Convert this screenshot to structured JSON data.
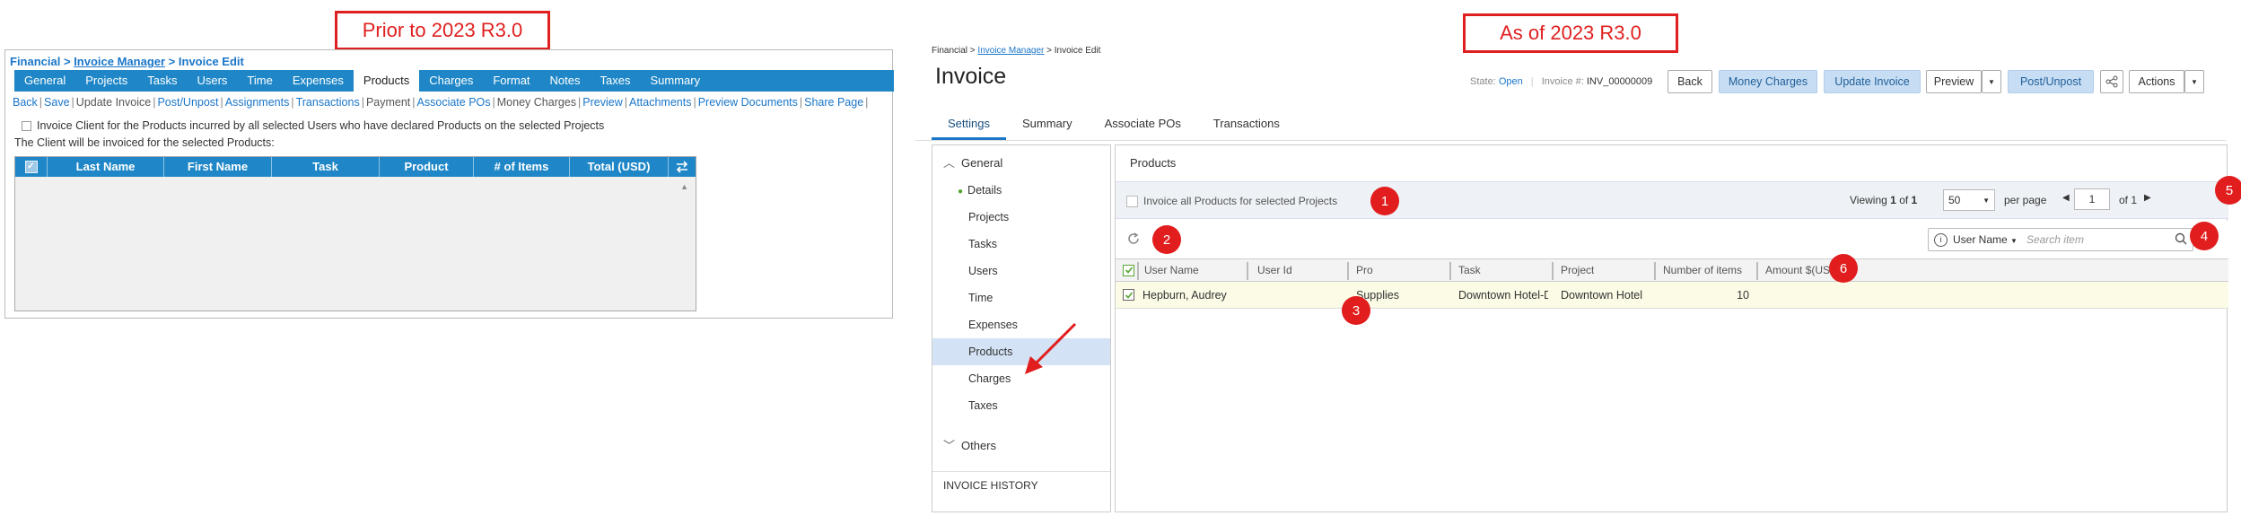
{
  "captions": {
    "before": "Prior to 2023 R3.0",
    "after": "As of 2023 R3.0"
  },
  "old_ui": {
    "breadcrumb": {
      "part1": "Financial",
      "sep": " > ",
      "part2": "Invoice Manager",
      "part3": "Invoice Edit"
    },
    "tabs": [
      "General",
      "Projects",
      "Tasks",
      "Users",
      "Time",
      "Expenses",
      "Products",
      "Charges",
      "Format",
      "Notes",
      "Taxes",
      "Summary"
    ],
    "links": [
      "Back",
      "Save",
      "Update Invoice",
      "Post/Unpost",
      "Assignments",
      "Transactions",
      "Payment",
      "Associate POs",
      "Money Charges",
      "Preview",
      "Attachments",
      "Preview Documents",
      "Share Page"
    ],
    "checkbox_label": "Invoice Client for the Products incurred by all selected Users who have declared Products on the selected Projects",
    "info_line": "The Client will be invoiced for the selected Products:",
    "columns": [
      "Last Name",
      "First Name",
      "Task",
      "Product",
      "# of Items",
      "Total (USD)"
    ]
  },
  "new_ui": {
    "breadcrumb": {
      "part1": "Financial > ",
      "part2": "Invoice Manager",
      "part3": " > Invoice Edit"
    },
    "title": "Invoice",
    "state_label": "State:",
    "state_value": "Open",
    "invoice_label": "Invoice #:",
    "invoice_value": "INV_00000009",
    "buttons": {
      "back": "Back",
      "money_charges": "Money Charges",
      "update_invoice": "Update Invoice",
      "preview": "Preview",
      "post_unpost": "Post/Unpost",
      "actions": "Actions"
    },
    "tabs": [
      "Settings",
      "Summary",
      "Associate POs",
      "Transactions"
    ],
    "sidebar": {
      "general": "General",
      "items": [
        "Details",
        "Projects",
        "Tasks",
        "Users",
        "Time",
        "Expenses",
        "Products",
        "Charges",
        "Taxes"
      ],
      "others": "Others",
      "history": "INVOICE HISTORY"
    },
    "main": {
      "title": "Products",
      "invoice_all_label": "Invoice all Products for selected Projects",
      "viewing": "Viewing",
      "range_start": "1",
      "of_word": "of",
      "range_total": "1",
      "page_size": "50",
      "per_page": "per page",
      "page": "1",
      "page_total_label": "of 1",
      "search_field": "User Name",
      "search_placeholder": "Search item",
      "columns": [
        "User Name",
        "User Id",
        "Pro",
        "Task",
        "Project",
        "Number of items",
        "Amount $(US"
      ],
      "row": {
        "user_name": "Hepburn, Audrey",
        "user_id": "",
        "product": "Supplies",
        "task": "Downtown Hotel-DOWNT...",
        "project": "Downtown Hotel",
        "items": "10"
      }
    },
    "badges": [
      "1",
      "2",
      "3",
      "4",
      "5",
      "6"
    ]
  }
}
